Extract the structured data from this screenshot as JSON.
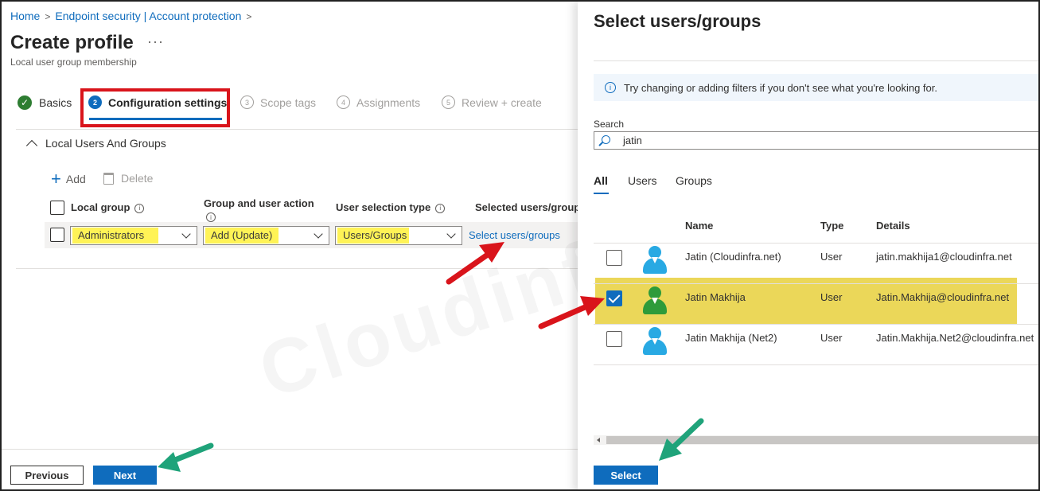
{
  "breadcrumb": [
    "Home",
    "Endpoint security | Account protection"
  ],
  "page": {
    "title": "Create profile",
    "more": "···",
    "subtitle": "Local user group membership"
  },
  "steps": [
    {
      "num": "",
      "label": "Basics",
      "state": "done"
    },
    {
      "num": "2",
      "label": "Configuration settings",
      "state": "active"
    },
    {
      "num": "3",
      "label": "Scope tags",
      "state": "disabled"
    },
    {
      "num": "4",
      "label": "Assignments",
      "state": "disabled"
    },
    {
      "num": "5",
      "label": "Review + create",
      "state": "disabled"
    }
  ],
  "section": {
    "label": "Local Users And Groups"
  },
  "commands": {
    "add": "Add",
    "delete": "Delete"
  },
  "columns": {
    "local_group": "Local group",
    "action": "Group and user action",
    "selection_type": "User selection type",
    "selected": "Selected users/groups"
  },
  "row": {
    "local_group": "Administrators",
    "action": "Add (Update)",
    "selection_type": "Users/Groups",
    "select_link": "Select users/groups"
  },
  "footer": {
    "previous": "Previous",
    "next": "Next"
  },
  "panel": {
    "title": "Select users/groups",
    "info": "Try changing or adding filters if you don't see what you're looking for.",
    "search_label": "Search",
    "search_value": "jatin",
    "tabs": [
      "All",
      "Users",
      "Groups"
    ],
    "headers": {
      "name": "Name",
      "type": "Type",
      "details": "Details"
    },
    "results": [
      {
        "name": "Jatin (Cloudinfra.net)",
        "type": "User",
        "details": "jatin.makhija1@cloudinfra.net",
        "checked": false
      },
      {
        "name": "Jatin Makhija",
        "type": "User",
        "details": "Jatin.Makhija@cloudinfra.net",
        "checked": true
      },
      {
        "name": "Jatin Makhija (Net2)",
        "type": "User",
        "details": "Jatin.Makhija.Net2@cloudinfra.net",
        "checked": false
      }
    ],
    "select_button": "Select"
  },
  "watermark": "Cloudinfra.net",
  "colors": {
    "accent": "#0f6cbd",
    "highlight": "#fff34d",
    "annotation_red": "#d9141b",
    "annotation_green": "#1fa37a",
    "success": "#2e7d32"
  }
}
